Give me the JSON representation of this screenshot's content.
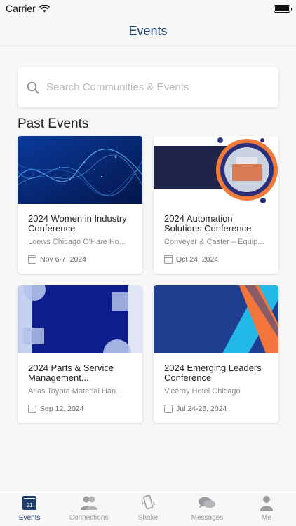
{
  "status": {
    "carrier": "Carrier"
  },
  "nav": {
    "title": "Events"
  },
  "search": {
    "placeholder": "Search Communities & Events"
  },
  "section": {
    "title": "Past Events"
  },
  "events": [
    {
      "title": "2024 Women in Industry Conference",
      "venue": "Loews Chicago O'Hare Ho...",
      "date": "Nov 6-7, 2024"
    },
    {
      "title": "2024 Automation Solutions Conference",
      "venue": "Conveyer & Caster – Equip...",
      "date": "Oct 24, 2024"
    },
    {
      "title": "2024 Parts & Service Management...",
      "venue": "Atlas Toyota Material Han...",
      "date": "Sep 12, 2024"
    },
    {
      "title": "2024 Emerging Leaders Conference",
      "venue": "Viceroy Hotel Chicago",
      "date": "Jul 24-25, 2024"
    }
  ],
  "tabs": [
    {
      "label": "Events",
      "icon": "calendar-icon",
      "badge": "21"
    },
    {
      "label": "Connections",
      "icon": "people-icon"
    },
    {
      "label": "Shake",
      "icon": "phone-shake-icon"
    },
    {
      "label": "Messages",
      "icon": "chat-bubbles-icon"
    },
    {
      "label": "Me",
      "icon": "person-icon"
    }
  ],
  "colors": {
    "accent": "#1f3f6b",
    "inactive": "#9b9ba0"
  }
}
